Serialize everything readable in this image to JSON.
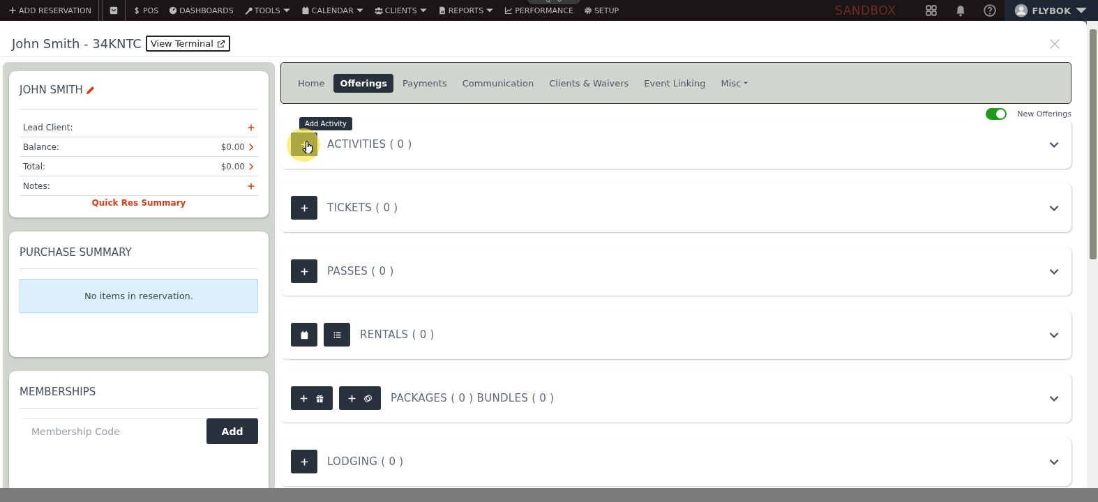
{
  "top_nav": {
    "items": [
      {
        "label": "ADD RESERVATION",
        "dropdown": false
      },
      {
        "dropdown": false
      },
      {
        "label": "POS",
        "dropdown": false
      },
      {
        "label": "DASHBOARDS",
        "dropdown": false
      },
      {
        "label": "TOOLS",
        "dropdown": true
      },
      {
        "label": "CALENDAR",
        "dropdown": true
      },
      {
        "label": "CLIENTS",
        "dropdown": true
      },
      {
        "label": "REPORTS",
        "dropdown": true
      },
      {
        "label": "PERFORMANCE",
        "dropdown": false
      },
      {
        "label": "SETUP",
        "dropdown": false
      }
    ],
    "environment": "SANDBOX",
    "account": "FLYBOK"
  },
  "modal": {
    "title": "John Smith - 34KNTC",
    "terminal_button": "View Terminal"
  },
  "client_card": {
    "name": "JOHN SMITH",
    "rows": [
      {
        "label": "Lead Client:",
        "kind": "add"
      },
      {
        "label": "Balance:",
        "value": "$0.00",
        "kind": "link"
      },
      {
        "label": "Total:",
        "value": "$0.00",
        "kind": "link"
      },
      {
        "label": "Notes:",
        "kind": "add"
      }
    ],
    "summary_link": "Quick Res Summary"
  },
  "purchase_summary": {
    "title": "PURCHASE SUMMARY",
    "empty_message": "No items in reservation."
  },
  "memberships": {
    "title": "MEMBERSHIPS",
    "placeholder": "Membership Code",
    "add_button": "Add"
  },
  "tabs": [
    {
      "label": "Home",
      "selected": false,
      "dropdown": false
    },
    {
      "label": "Offerings",
      "selected": true,
      "dropdown": false
    },
    {
      "label": "Payments",
      "selected": false,
      "dropdown": false
    },
    {
      "label": "Communication",
      "selected": false,
      "dropdown": false
    },
    {
      "label": "Clients & Waivers",
      "selected": false,
      "dropdown": false
    },
    {
      "label": "Event Linking",
      "selected": false,
      "dropdown": false
    },
    {
      "label": "Misc",
      "selected": false,
      "dropdown": true
    }
  ],
  "new_offerings_toggle": {
    "label": "New Offerings",
    "on": true
  },
  "sections": [
    {
      "title": "ACTIVITIES ( 0 )",
      "buttons": [
        {
          "kind": "plus"
        }
      ],
      "tooltip": "Add Activity"
    },
    {
      "title": "TICKETS ( 0 )",
      "buttons": [
        {
          "kind": "plus"
        }
      ]
    },
    {
      "title": "PASSES ( 0 )",
      "buttons": [
        {
          "kind": "plus"
        }
      ]
    },
    {
      "title": "RENTALS ( 0 )",
      "buttons": [
        {
          "kind": "calendar"
        },
        {
          "kind": "list"
        }
      ]
    },
    {
      "title": "PACKAGES ( 0 ) BUNDLES ( 0 )",
      "buttons": [
        {
          "kind": "plus-gift"
        },
        {
          "kind": "plus-rings"
        }
      ]
    },
    {
      "title": "LODGING ( 0 )",
      "buttons": [
        {
          "kind": "plus"
        }
      ]
    }
  ]
}
